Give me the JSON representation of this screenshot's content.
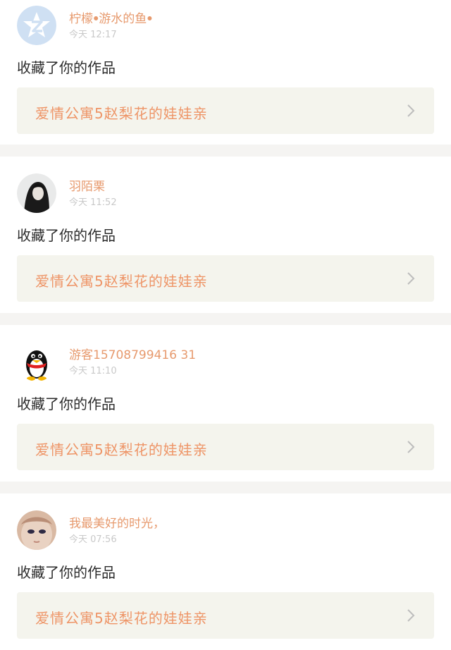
{
  "feed": [
    {
      "user": "柠檬ꔷ游水的鱼ꔷ",
      "time": "今天 12:17",
      "action": "收藏了你的作品",
      "work": "爱情公寓5赵梨花的娃娃亲",
      "avatar": "qzone-star"
    },
    {
      "user": "羽陌栗",
      "time": "今天 11:52",
      "action": "收藏了你的作品",
      "work": "爱情公寓5赵梨花的娃娃亲",
      "avatar": "portrait-dark"
    },
    {
      "user": "游客15708799416 31",
      "time": "今天 11:10",
      "action": "收藏了你的作品",
      "work": "爱情公寓5赵梨花的娃娃亲",
      "avatar": "qq-penguin"
    },
    {
      "user": "我最美好的时光，",
      "time": "今天 07:56",
      "action": "收藏了你的作品",
      "work": "爱情公寓5赵梨花的娃娃亲",
      "avatar": "portrait-face"
    }
  ],
  "icons": {
    "chevron": "chevron-right-icon"
  },
  "colors": {
    "username": "#e79a6e",
    "work_title": "#ee9466",
    "link_bg": "#f4f4ed",
    "page_bg": "#f5f4f2"
  }
}
